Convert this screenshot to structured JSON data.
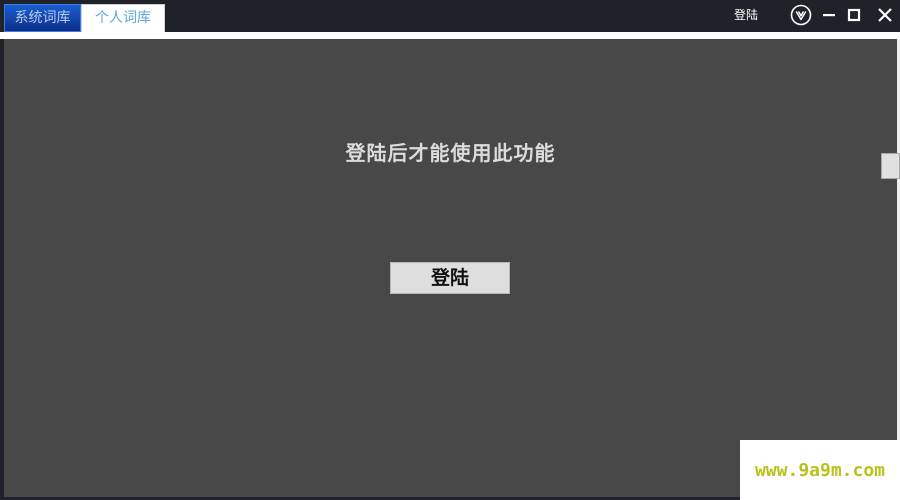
{
  "titlebar": {
    "tabs": [
      {
        "label": "系统词库",
        "active": false
      },
      {
        "label": "个人词库",
        "active": true
      }
    ],
    "login_label": "登陆",
    "icons": {
      "skin": "v-circle-icon",
      "minimize": "minimize-icon",
      "maximize": "maximize-icon",
      "close": "close-icon"
    }
  },
  "main": {
    "message": "登陆后才能使用此功能",
    "login_button": "登陆"
  },
  "watermark": {
    "text": "www.9a9m.com"
  },
  "colors": {
    "titlebar_bg": "#1f2228",
    "content_bg": "#484848",
    "active_tab_text": "#5da6dc",
    "system_tab_bg": "#1a5fd0",
    "watermark_text": "#b9c21c"
  }
}
